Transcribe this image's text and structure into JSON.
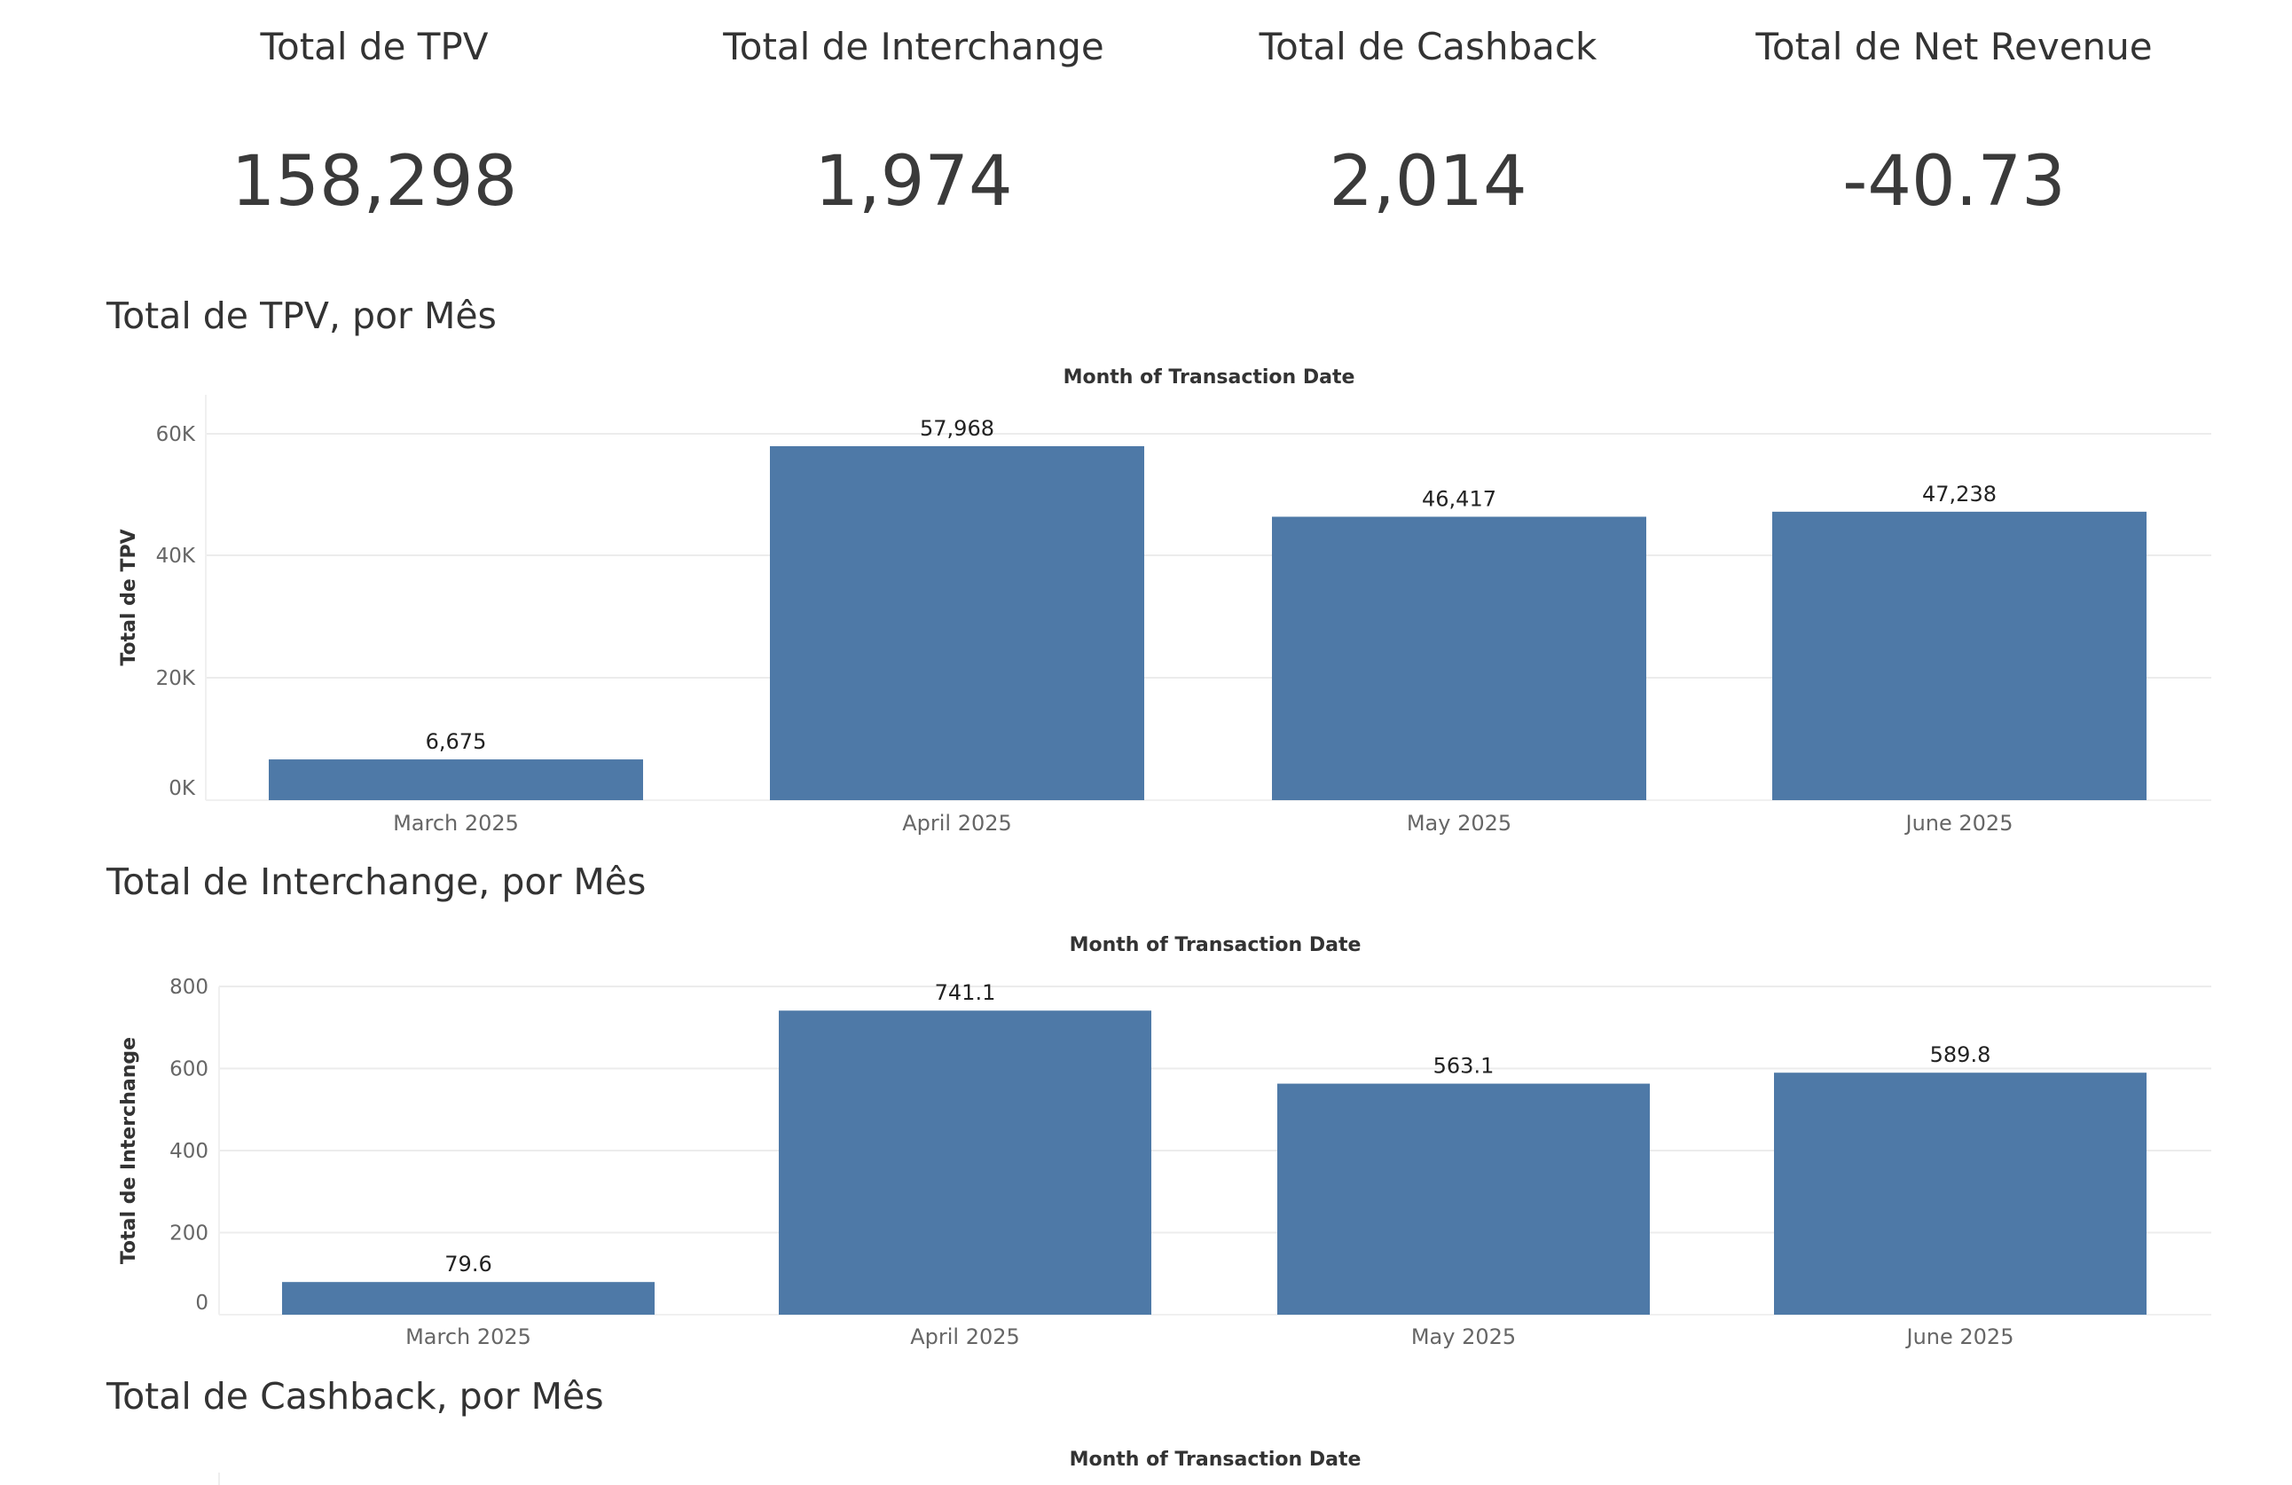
{
  "kpis": [
    {
      "label": "Total de TPV",
      "value": "158,298"
    },
    {
      "label": "Total de Interchange",
      "value": "1,974"
    },
    {
      "label": "Total de Cashback",
      "value": "2,014"
    },
    {
      "label": "Total de Net Revenue",
      "value": "-40.73"
    }
  ],
  "sections": {
    "tpv": {
      "title": "Total de TPV, por Mês"
    },
    "interchange": {
      "title": "Total de Interchange, por Mês"
    },
    "cashback": {
      "title": "Total de Cashback, por Mês"
    }
  },
  "colors": {
    "bar": "#4e79a7",
    "grid": "#ececec"
  },
  "chart_data": [
    {
      "type": "bar",
      "title": "Total de TPV, por Mês",
      "xlabel": "Month of Transaction Date",
      "ylabel": "Total de TPV",
      "categories": [
        "March 2025",
        "April 2025",
        "May 2025",
        "June 2025"
      ],
      "values": [
        6675,
        57968,
        46417,
        47238
      ],
      "data_labels": [
        "6,675",
        "57,968",
        "46,417",
        "47,238"
      ],
      "yticks": [
        0,
        20000,
        40000,
        60000
      ],
      "ytick_labels": [
        "0K",
        "20K",
        "40K",
        "60K"
      ],
      "ylim": [
        0,
        66000
      ],
      "grid": true
    },
    {
      "type": "bar",
      "title": "Total de Interchange, por Mês",
      "xlabel": "Month of Transaction Date",
      "ylabel": "Total de Interchange",
      "categories": [
        "March 2025",
        "April 2025",
        "May 2025",
        "June 2025"
      ],
      "values": [
        79.6,
        741.1,
        563.1,
        589.8
      ],
      "data_labels": [
        "79.6",
        "741.1",
        "563.1",
        "589.8"
      ],
      "yticks": [
        0,
        200,
        400,
        600,
        800
      ],
      "ytick_labels": [
        "0",
        "200",
        "400",
        "600",
        "800"
      ],
      "ylim": [
        0,
        800
      ],
      "grid": true
    },
    {
      "type": "bar",
      "title": "Total de Cashback, por Mês",
      "xlabel": "Month of Transaction Date"
    }
  ]
}
